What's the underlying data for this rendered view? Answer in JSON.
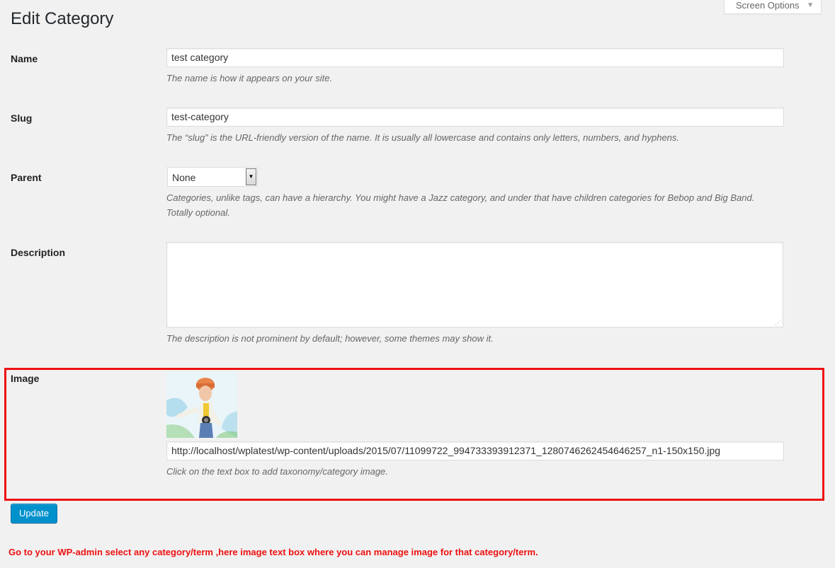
{
  "screen_options": {
    "label": "Screen Options",
    "arrow": "▼"
  },
  "page": {
    "title": "Edit Category"
  },
  "form": {
    "name": {
      "label": "Name",
      "value": "test category",
      "description": "The name is how it appears on your site."
    },
    "slug": {
      "label": "Slug",
      "value": "test-category",
      "description": "The “slug” is the URL-friendly version of the name. It is usually all lowercase and contains only letters, numbers, and hyphens."
    },
    "parent": {
      "label": "Parent",
      "selected": "None",
      "description_line1": "Categories, unlike tags, can have a hierarchy. You might have a Jazz category, and under that have children categories for Bebop and Big Band.",
      "description_line2": "Totally optional."
    },
    "description": {
      "label": "Description",
      "value": "",
      "help": "The description is not prominent by default; however, some themes may show it."
    },
    "image": {
      "label": "Image",
      "url": "http://localhost/wplatest/wp-content/uploads/2015/07/11099722_994733393912371_1280746262454646257_n1-150x150.jpg",
      "help": "Click on the text box to add taxonomy/category image."
    },
    "update_label": "Update"
  },
  "annotation": {
    "text": "Go to your WP-admin select any category/term ,here image text box where you can manage image for that category/term."
  },
  "colors": {
    "accent": "#0091cd",
    "highlight": "#ee1111",
    "background": "#f1f1f1"
  }
}
